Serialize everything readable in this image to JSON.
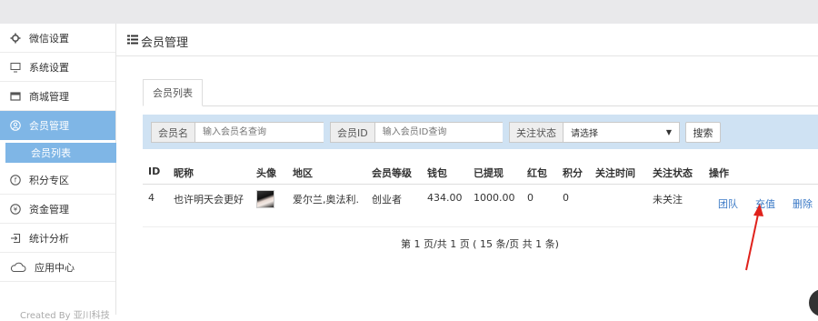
{
  "sidebar": {
    "items": [
      {
        "icon": "gear-icon",
        "label": "微信设置",
        "active": false
      },
      {
        "icon": "monitor-icon",
        "label": "系统设置",
        "active": false
      },
      {
        "icon": "store-icon",
        "label": "商城管理",
        "active": false
      },
      {
        "icon": "user-circle-icon",
        "label": "会员管理",
        "active": true
      },
      {
        "icon": "points-icon",
        "label": "积分专区",
        "active": false
      },
      {
        "icon": "yuan-icon",
        "label": "资金管理",
        "active": false
      },
      {
        "icon": "login-icon",
        "label": "统计分析",
        "active": false
      },
      {
        "icon": "cloud-icon",
        "label": "应用中心",
        "active": false
      }
    ],
    "sub_item": "会员列表",
    "footer": "Created By 亚川科技"
  },
  "main": {
    "title": "会员管理",
    "tab": "会员列表",
    "filters": {
      "name_label": "会员名",
      "name_placeholder": "输入会员名查询",
      "id_label": "会员ID",
      "id_placeholder": "输入会员ID查询",
      "status_label": "关注状态",
      "status_value": "请选择",
      "search_button": "搜索"
    },
    "table": {
      "headers": [
        "ID",
        "昵称",
        "头像",
        "地区",
        "会员等级",
        "钱包",
        "已提现",
        "红包",
        "积分",
        "关注时间",
        "关注状态",
        "操作"
      ],
      "rows": [
        {
          "id": "4",
          "nickname": "也许明天会更好",
          "region": "爱尔兰,奥法利.",
          "level": "创业者",
          "wallet": "434.00",
          "withdrawn": "1000.00",
          "red_packet": "0",
          "points": "0",
          "follow_time": "",
          "follow_status": "未关注",
          "actions": [
            "团队",
            "充值",
            "删除"
          ]
        }
      ]
    },
    "pager": "第 1 页/共 1 页 ( 15 条/页 共 1 条)"
  },
  "colors": {
    "accent": "#7fb6e6",
    "filter_bg": "#cfe2f3",
    "link": "#3a79c6",
    "annotation_arrow": "#e0221c"
  }
}
